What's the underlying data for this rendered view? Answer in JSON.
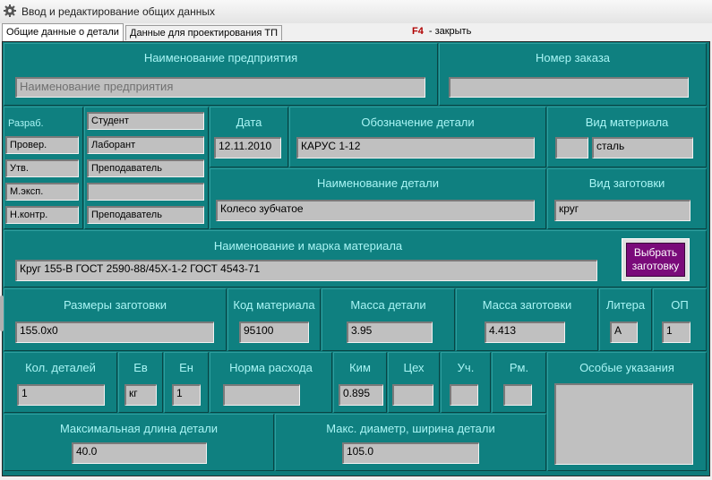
{
  "window": {
    "title": "Ввод и редактирование общих данных",
    "icon": "gear-icon"
  },
  "tabs": [
    {
      "label": "Общие данные о детали",
      "active": true
    },
    {
      "label": "Данные для проектирования ТП",
      "active": false
    }
  ],
  "hint": {
    "key": "F4",
    "text": "- закрыть"
  },
  "enterprise": {
    "label": "Наименование предприятия",
    "value": "Наименование предприятия"
  },
  "order": {
    "label": "Номер заказа",
    "value": ""
  },
  "signatures": {
    "roles": [
      "Разраб.",
      "Провер.",
      "Утв.",
      "М.эксп.",
      "Н.контр."
    ],
    "names": [
      "Студент",
      "Лаборант",
      "Преподаватель",
      "",
      "Преподаватель"
    ]
  },
  "date": {
    "label": "Дата",
    "value": "12.11.2010"
  },
  "designation": {
    "label": "Обозначение детали",
    "value": "КАРУС 1-12"
  },
  "material_type": {
    "label": "Вид материала",
    "code": "",
    "value": "сталь"
  },
  "part_name": {
    "label": "Наименование детали",
    "value": "Колесо зубчатое"
  },
  "blank_type": {
    "label": "Вид заготовки",
    "value": "круг"
  },
  "material": {
    "label": "Наименование и марка материала",
    "value": "Круг 155-В ГОСТ 2590-88/45Х-1-2 ГОСТ 4543-71"
  },
  "choose_blank_button": {
    "line1": "Выбрать",
    "line2": "заготовку"
  },
  "blank_size": {
    "label": "Размеры заготовки",
    "value": "155.0x0"
  },
  "material_code": {
    "label": "Код материала",
    "value": "95100"
  },
  "part_mass": {
    "label": "Масса детали",
    "value": "3.95"
  },
  "blank_mass": {
    "label": "Масса заготовки",
    "value": "4.413"
  },
  "litera": {
    "label": "Литера",
    "value": "А"
  },
  "op": {
    "label": "ОП",
    "value": "1"
  },
  "qty": {
    "label": "Кол. деталей",
    "value": "1"
  },
  "ev": {
    "label": "Ев",
    "value": "кг"
  },
  "en": {
    "label": "Ен",
    "value": "1"
  },
  "norm": {
    "label": "Норма расхода",
    "value": ""
  },
  "kim": {
    "label": "Ким",
    "value": "0.895"
  },
  "shop": {
    "label": "Цех",
    "value": ""
  },
  "section": {
    "label": "Уч.",
    "value": ""
  },
  "workplace": {
    "label": "Рм.",
    "value": ""
  },
  "special": {
    "label": "Особые указания",
    "value": ""
  },
  "max_length": {
    "label": "Максимальная длина детали",
    "value": "40.0"
  },
  "max_diameter": {
    "label": "Макс. диаметр, ширина детали",
    "value": "105.0"
  }
}
